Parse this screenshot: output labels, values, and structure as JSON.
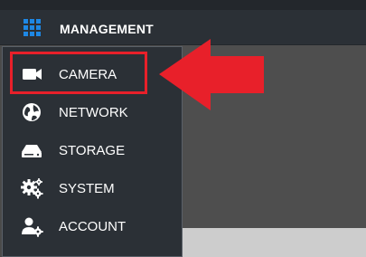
{
  "header": {
    "title": "MANAGEMENT",
    "icon": "grid-icon"
  },
  "menu": {
    "items": [
      {
        "label": "CAMERA",
        "icon": "camera-icon",
        "highlighted": true
      },
      {
        "label": "NETWORK",
        "icon": "globe-icon"
      },
      {
        "label": "STORAGE",
        "icon": "hard-drive-icon"
      },
      {
        "label": "SYSTEM",
        "icon": "gears-icon"
      },
      {
        "label": "ACCOUNT",
        "icon": "user-gear-icon"
      }
    ]
  },
  "colors": {
    "accent": "#1e88e5",
    "annotation": "#e8202a",
    "menu_bg": "#2b3036"
  }
}
